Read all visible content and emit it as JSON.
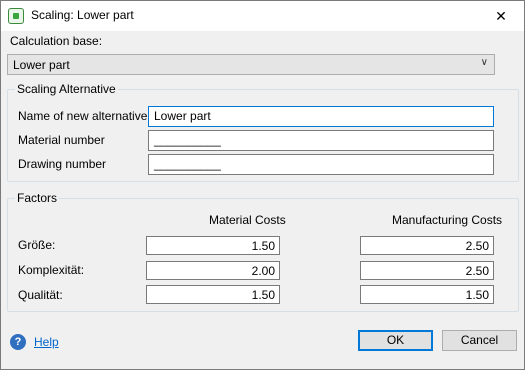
{
  "window": {
    "title": "Scaling: Lower part",
    "close_glyph": "✕",
    "icon": "app-icon"
  },
  "calculation_base": {
    "label": "Calculation base:",
    "selected": "Lower part",
    "chevron": "∨"
  },
  "scaling_alternative": {
    "title": "Scaling Alternative",
    "name_label": "Name of new alternative:",
    "name_value": "Lower part",
    "material_label": "Material number",
    "material_value": "__________",
    "drawing_label": "Drawing number",
    "drawing_value": "__________"
  },
  "factors": {
    "title": "Factors",
    "col_material": "Material Costs",
    "col_manufacturing": "Manufacturing Costs",
    "rows": [
      {
        "label": "Größe:",
        "material": "1.50",
        "manufacturing": "2.50"
      },
      {
        "label": "Komplexität:",
        "material": "2.00",
        "manufacturing": "2.50"
      },
      {
        "label": "Qualität:",
        "material": "1.50",
        "manufacturing": "1.50"
      }
    ]
  },
  "footer": {
    "help_glyph": "?",
    "help_label": "Help",
    "ok_label": "OK",
    "cancel_label": "Cancel"
  },
  "colors": {
    "accent": "#0078d7",
    "link": "#0066cc",
    "group_border": "#d5dfe5"
  }
}
